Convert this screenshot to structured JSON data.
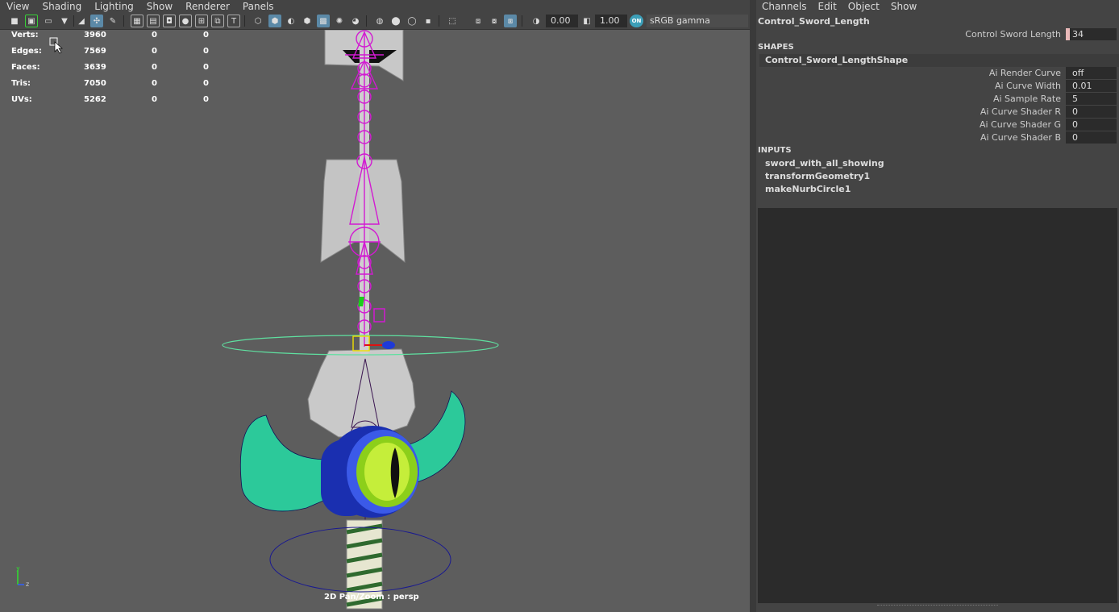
{
  "viewport": {
    "menu": [
      "View",
      "Shading",
      "Lighting",
      "Show",
      "Renderer",
      "Panels"
    ],
    "exposure": "0.00",
    "gamma": "1.00",
    "color_mgmt_toggle": "ON",
    "color_space": "sRGB gamma",
    "hud": [
      {
        "label": "Verts:",
        "v1": "3960",
        "v2": "0",
        "v3": "0"
      },
      {
        "label": "Edges:",
        "v1": "7569",
        "v2": "0",
        "v3": "0"
      },
      {
        "label": "Faces:",
        "v1": "3639",
        "v2": "0",
        "v3": "0"
      },
      {
        "label": "Tris:",
        "v1": "7050",
        "v2": "0",
        "v3": "0"
      },
      {
        "label": "UVs:",
        "v1": "5262",
        "v2": "0",
        "v3": "0"
      }
    ],
    "camera_label": "2D Pan/Zoom : persp",
    "axis": {
      "y": "y",
      "z": "z"
    }
  },
  "channel_box": {
    "menu": [
      "Channels",
      "Edit",
      "Object",
      "Show"
    ],
    "node_name": "Control_Sword_Length",
    "transform_attrs": [
      {
        "name": "Control Sword Length",
        "value": "34"
      }
    ],
    "shapes_header": "SHAPES",
    "shape_name": "Control_Sword_LengthShape",
    "shape_attrs": [
      {
        "name": "Ai Render Curve",
        "value": "off"
      },
      {
        "name": "Ai Curve Width",
        "value": "0.01"
      },
      {
        "name": "Ai Sample Rate",
        "value": "5"
      },
      {
        "name": "Ai Curve Shader R",
        "value": "0"
      },
      {
        "name": "Ai Curve Shader G",
        "value": "0"
      },
      {
        "name": "Ai Curve Shader B",
        "value": "0"
      }
    ],
    "inputs_header": "INPUTS",
    "inputs": [
      "sword_with_all_showing",
      "transformGeometry1",
      "makeNurbCircle1"
    ]
  },
  "colors": {
    "viewport_bg": "#5d5d5d",
    "rig_magenta": "#d21ad2",
    "ring_green": "#5fe0a0",
    "accent_blue": "#5b89a7"
  }
}
